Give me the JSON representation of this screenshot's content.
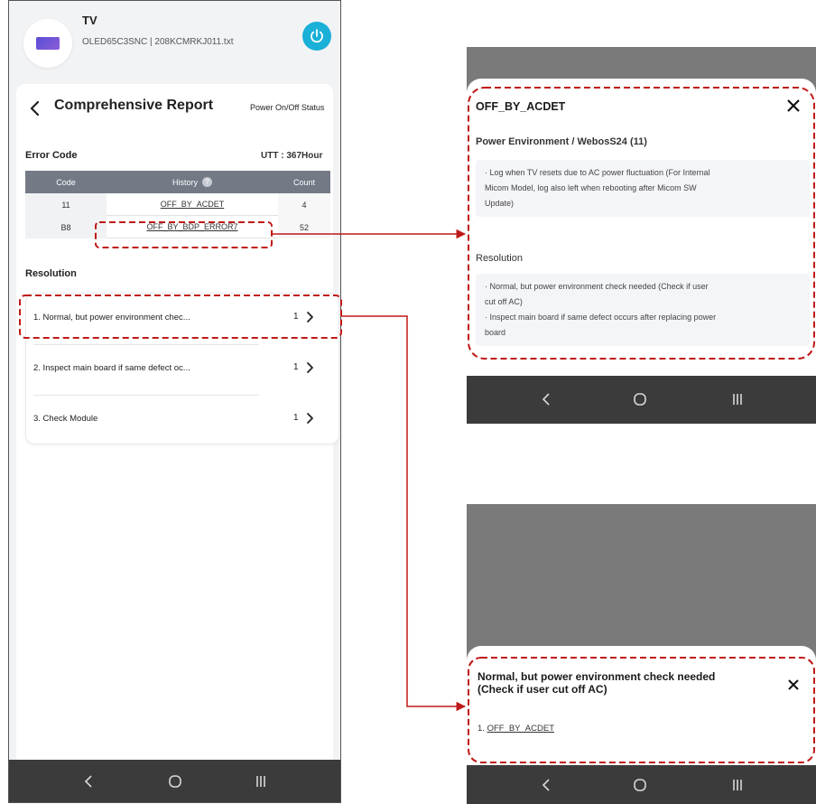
{
  "device": {
    "name": "TV",
    "model": "OLED65C3SNC | 208KCMRKJ011.txt"
  },
  "report": {
    "title": "Comprehensive Report",
    "power_status_label": "Power On/Off Status"
  },
  "error_code": {
    "label": "Error Code",
    "utt": "UTT : 367Hour",
    "headers": [
      "Code",
      "History",
      "Count"
    ],
    "help_glyph": "?",
    "rows": [
      {
        "code": "11",
        "history": "OFF_BY_ACDET",
        "count": "4"
      },
      {
        "code": "B8",
        "history": "OFF_BY_BDP_ERROR7",
        "count": "52"
      }
    ]
  },
  "resolution": {
    "label": "Resolution",
    "items": [
      {
        "text": "1. Normal, but power environment chec...",
        "count": "1"
      },
      {
        "text": "2. Inspect main board if same defect oc...",
        "count": "1"
      },
      {
        "text": "3. Check Module",
        "count": "1"
      }
    ]
  },
  "detail_sheet": {
    "title": "OFF_BY_ACDET",
    "env_title": "Power Environment / WebosS24 (11)",
    "desc_lines": [
      "· Log when TV resets due to AC power fluctuation (For Internal",
      "Micom Model, log also left when rebooting after Micom SW",
      "Update)"
    ],
    "resolution_title": "Resolution",
    "resolution_lines": [
      "· Normal, but power environment check needed (Check if user",
      "cut off AC)",
      "· Inspect main board if same defect occurs after replacing power",
      "board"
    ]
  },
  "resolution_sheet": {
    "title_line1": "Normal, but power environment check needed",
    "title_line2": "(Check if user cut off AC)",
    "item_prefix": "1. ",
    "item_link": "OFF_BY_ACDET"
  },
  "colors": {
    "power_button": "#1ab0d8",
    "table_header": "#737a86",
    "annotation": "#c01818",
    "nav_bar": "#3b3b3b"
  },
  "icons": {
    "back": "chevron-left-icon",
    "power": "power-icon",
    "help": "help-icon",
    "chevron": "chevron-right-icon",
    "close": "close-icon",
    "nav_back": "nav-back-icon",
    "nav_home": "nav-home-icon",
    "nav_recents": "nav-recents-icon"
  }
}
